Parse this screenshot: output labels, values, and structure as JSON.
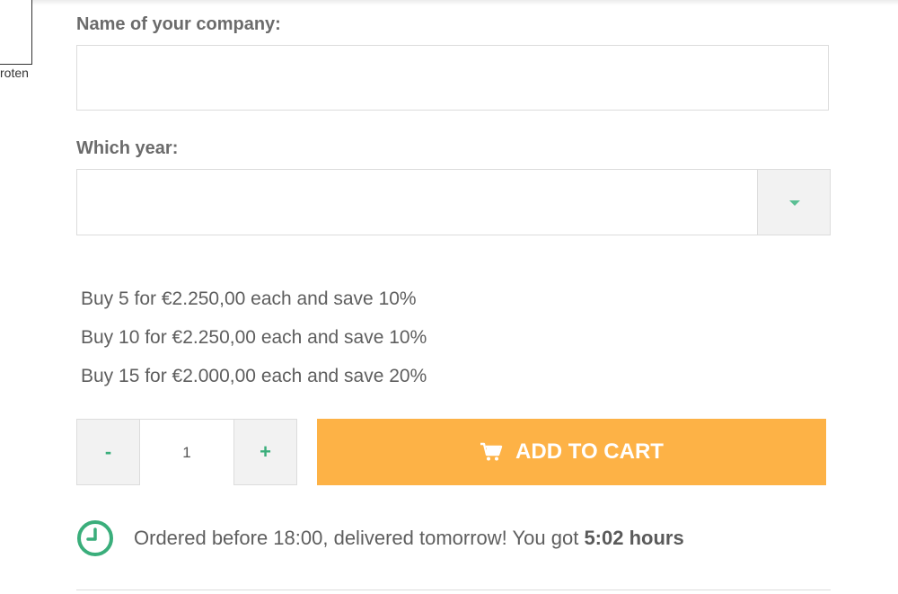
{
  "left_caption": "roten",
  "form": {
    "company_label": "Name of your company:",
    "company_value": "",
    "year_label": "Which year:",
    "year_value": ""
  },
  "discounts": [
    "Buy 5 for €2.250,00 each and save 10%",
    "Buy 10 for €2.250,00 each and save 10%",
    "Buy 15 for €2.000,00 each and save 20%"
  ],
  "quantity": {
    "minus_label": "-",
    "value": "1",
    "plus_label": "+"
  },
  "cart": {
    "label": "ADD TO CART",
    "icon": "cart-icon"
  },
  "delivery": {
    "icon": "clock-icon",
    "text": "Ordered before 18:00, delivered tomorrow! You got",
    "time": "5:02 hours"
  },
  "colors": {
    "accent_green": "#3aae7b",
    "cart_orange": "#fdb246",
    "text": "#5e5e5e"
  }
}
